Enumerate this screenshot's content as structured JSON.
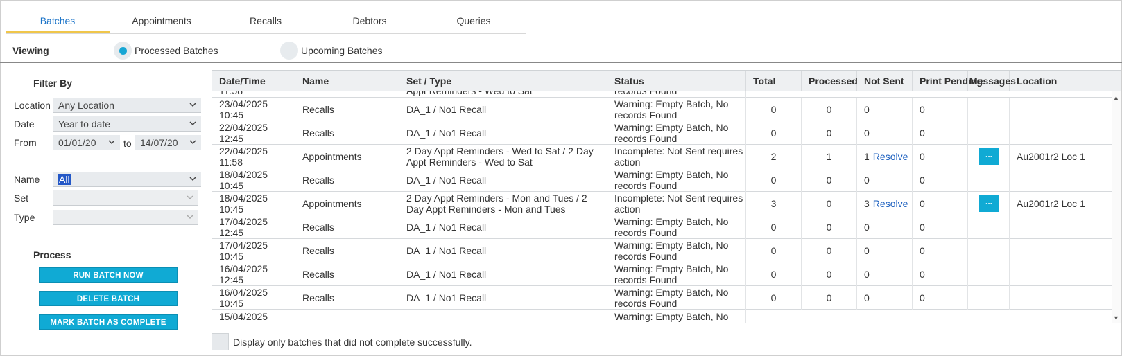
{
  "tabs": [
    {
      "label": "Batches",
      "active": true
    },
    {
      "label": "Appointments",
      "active": false
    },
    {
      "label": "Recalls",
      "active": false
    },
    {
      "label": "Debtors",
      "active": false
    },
    {
      "label": "Queries",
      "active": false
    }
  ],
  "viewing": {
    "label": "Viewing",
    "options": [
      {
        "label": "Processed Batches",
        "selected": true
      },
      {
        "label": "Upcoming Batches",
        "selected": false
      }
    ]
  },
  "filter": {
    "title": "Filter By",
    "location_label": "Location",
    "location_value": "Any Location",
    "date_label": "Date",
    "date_value": "Year to date",
    "from_label": "From",
    "from_value": "01/01/20",
    "to_label": "to",
    "to_value": "14/07/20",
    "name_label": "Name",
    "name_value": "All",
    "set_label": "Set",
    "set_value": "",
    "type_label": "Type",
    "type_value": ""
  },
  "process": {
    "title": "Process",
    "run_label": "RUN BATCH NOW",
    "delete_label": "DELETE BATCH",
    "complete_label": "MARK BATCH AS COMPLETE"
  },
  "grid": {
    "columns": [
      "Date/Time",
      "Name",
      "Set / Type",
      "Status",
      "Total",
      "Processed",
      "Not Sent",
      "Print Pending",
      "Messages",
      "Location"
    ],
    "partial_top": {
      "datetime": "11:58",
      "set": "Appt Reminders - Wed to Sat",
      "status": "records Found"
    },
    "rows": [
      {
        "date": "23/04/2025",
        "time": "10:45",
        "name": "Recalls",
        "set": "DA_1 / No1 Recall",
        "status": "Warning: Empty Batch, No records Found",
        "total": "0",
        "processed": "0",
        "not_sent": "0",
        "resolve": "",
        "print_pending": "0",
        "messages": "",
        "location": ""
      },
      {
        "date": "22/04/2025",
        "time": "12:45",
        "name": "Recalls",
        "set": "DA_1 / No1 Recall",
        "status": "Warning: Empty Batch, No records Found",
        "total": "0",
        "processed": "0",
        "not_sent": "0",
        "resolve": "",
        "print_pending": "0",
        "messages": "",
        "location": ""
      },
      {
        "date": "22/04/2025",
        "time": "11:58",
        "name": "Appointments",
        "set": "2 Day Appt Reminders - Wed to Sat / 2 Day Appt Reminders - Wed to Sat",
        "status": "Incomplete: Not Sent requires action",
        "total": "2",
        "processed": "1",
        "not_sent": "1",
        "resolve": "Resolve",
        "print_pending": "0",
        "messages": "...",
        "location": "Au2001r2 Loc 1"
      },
      {
        "date": "18/04/2025",
        "time": "10:45",
        "name": "Recalls",
        "set": "DA_1 / No1 Recall",
        "status": "Warning: Empty Batch, No records Found",
        "total": "0",
        "processed": "0",
        "not_sent": "0",
        "resolve": "",
        "print_pending": "0",
        "messages": "",
        "location": ""
      },
      {
        "date": "18/04/2025",
        "time": "10:45",
        "name": "Appointments",
        "set": "2 Day Appt Reminders - Mon and Tues / 2 Day Appt Reminders - Mon and Tues",
        "status": "Incomplete: Not Sent requires action",
        "total": "3",
        "processed": "0",
        "not_sent": "3",
        "resolve": "Resolve",
        "print_pending": "0",
        "messages": "...",
        "location": "Au2001r2 Loc 1"
      },
      {
        "date": "17/04/2025",
        "time": "12:45",
        "name": "Recalls",
        "set": "DA_1 / No1 Recall",
        "status": "Warning: Empty Batch, No records Found",
        "total": "0",
        "processed": "0",
        "not_sent": "0",
        "resolve": "",
        "print_pending": "0",
        "messages": "",
        "location": ""
      },
      {
        "date": "17/04/2025",
        "time": "10:45",
        "name": "Recalls",
        "set": "DA_1 / No1 Recall",
        "status": "Warning: Empty Batch, No records Found",
        "total": "0",
        "processed": "0",
        "not_sent": "0",
        "resolve": "",
        "print_pending": "0",
        "messages": "",
        "location": ""
      },
      {
        "date": "16/04/2025",
        "time": "12:45",
        "name": "Recalls",
        "set": "DA_1 / No1 Recall",
        "status": "Warning: Empty Batch, No records Found",
        "total": "0",
        "processed": "0",
        "not_sent": "0",
        "resolve": "",
        "print_pending": "0",
        "messages": "",
        "location": ""
      },
      {
        "date": "16/04/2025",
        "time": "10:45",
        "name": "Recalls",
        "set": "DA_1 / No1 Recall",
        "status": "Warning: Empty Batch, No records Found",
        "total": "0",
        "processed": "0",
        "not_sent": "0",
        "resolve": "",
        "print_pending": "0",
        "messages": "",
        "location": ""
      }
    ],
    "partial_bottom": {
      "datetime": "15/04/2025",
      "status": "Warning: Empty Batch, No"
    }
  },
  "footer": {
    "checkbox_label": "Display only batches that did not complete successfully.",
    "checked": false
  },
  "colors": {
    "accent": "#10aad4",
    "tab_active": "#1a73c8",
    "tab_underline": "#f0c64a",
    "link": "#1b5fbf"
  }
}
